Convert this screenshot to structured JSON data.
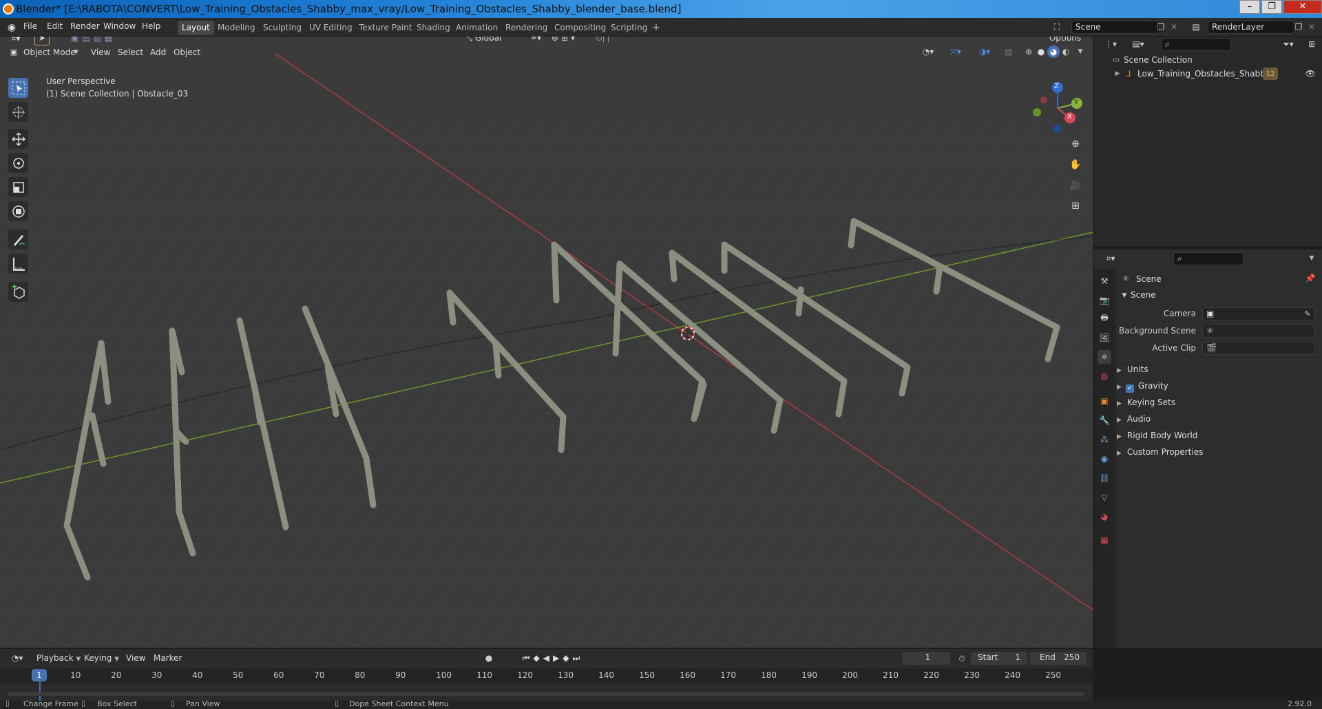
{
  "titlebar": {
    "title": "Blender* [E:\\RABOTA\\CONVERT\\Low_Training_Obstacles_Shabby_max_vray/Low_Training_Obstacles_Shabby_blender_base.blend]"
  },
  "menu": {
    "file": "File",
    "edit": "Edit",
    "render": "Render",
    "window": "Window",
    "help": "Help"
  },
  "workspaces": [
    "Layout",
    "Modeling",
    "Sculpting",
    "UV Editing",
    "Texture Paint",
    "Shading",
    "Animation",
    "Rendering",
    "Compositing",
    "Scripting"
  ],
  "scene_field": "Scene",
  "renderlayer_field": "RenderLayer",
  "viewport": {
    "transform_orientation": "Global",
    "options_label": "Options",
    "mode": "Object Mode",
    "menus": [
      "View",
      "Select",
      "Add",
      "Object"
    ],
    "perspective_label": "User Perspective",
    "collection_label": "(1) Scene Collection | Obstacle_03",
    "gizmo": {
      "z": "Z",
      "y": "Y",
      "x": "X"
    }
  },
  "outliner": {
    "root": "Scene Collection",
    "item": "Low_Training_Obstacles_Shabby",
    "item_badge": "12"
  },
  "properties": {
    "header": "Scene",
    "panel": "Scene",
    "camera_label": "Camera",
    "background_label": "Background Scene",
    "clip_label": "Active Clip",
    "sections": [
      "Units",
      "Gravity",
      "Keying Sets",
      "Audio",
      "Rigid Body World",
      "Custom Properties"
    ]
  },
  "timeline": {
    "menus": [
      "Playback",
      "Keying",
      "View",
      "Marker"
    ],
    "current_frame": "1",
    "start_label": "Start",
    "start_value": "1",
    "end_label": "End",
    "end_value": "250",
    "ticks": [
      "1",
      "10",
      "20",
      "30",
      "40",
      "50",
      "60",
      "70",
      "80",
      "90",
      "100",
      "110",
      "120",
      "130",
      "140",
      "150",
      "160",
      "170",
      "180",
      "190",
      "200",
      "210",
      "220",
      "230",
      "240",
      "250"
    ]
  },
  "statusbar": {
    "change_frame": "Change Frame",
    "box_select": "Box Select",
    "pan_view": "Pan View",
    "context_menu": "Dope Sheet Context Menu",
    "version": "2.92.0"
  },
  "colors": {
    "accent": "#4772b3",
    "x_axis": "#c0303a",
    "y_axis": "#6f9a2a",
    "viewport_bg": "#3d3d3d"
  }
}
